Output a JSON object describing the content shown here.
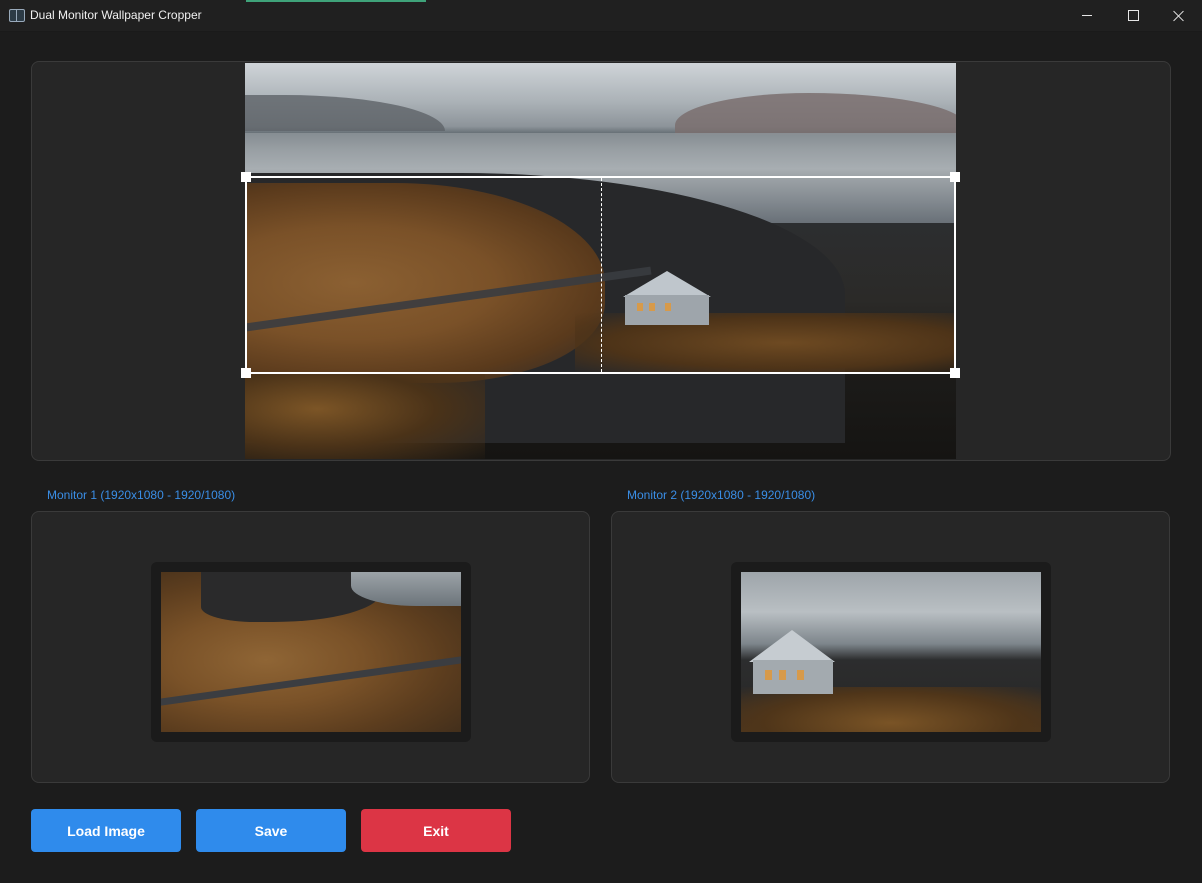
{
  "window": {
    "title": "Dual Monitor Wallpaper Cropper",
    "controls": [
      "minimize",
      "maximize",
      "close"
    ]
  },
  "main_preview": {
    "image": "landscape photo: coastline, sea, mountains, white house with car",
    "split": "2 halves (one per monitor)"
  },
  "monitors": [
    {
      "label": "Monitor 1 (1920x1080 - 1920/1080)"
    },
    {
      "label": "Monitor 2 (1920x1080 - 1920/1080)"
    }
  ],
  "buttons": {
    "load": "Load Image",
    "save": "Save",
    "exit": "Exit"
  },
  "colors": {
    "accent_blue": "#2f8bec",
    "danger_red": "#dc3545",
    "label_blue": "#3a8ee6",
    "background": "#1c1c1c",
    "panel": "#262626"
  }
}
